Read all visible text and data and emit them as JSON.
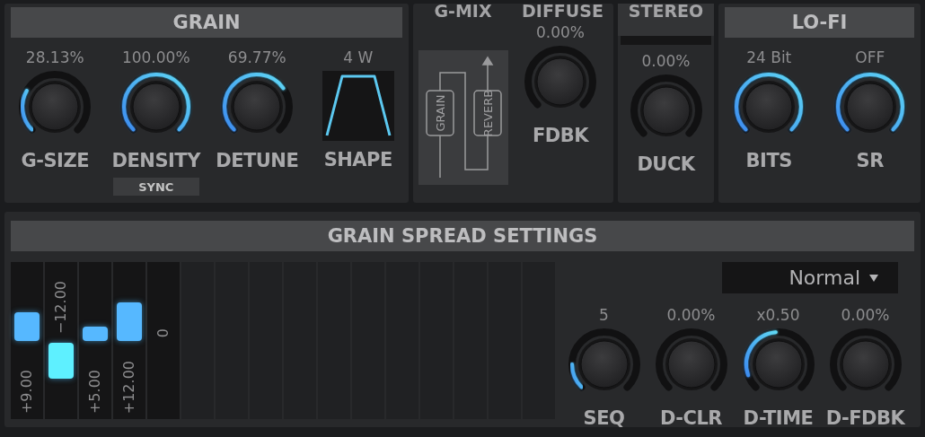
{
  "grain": {
    "title": "GRAIN",
    "controls": [
      {
        "kind": "knob",
        "value": "28.13%",
        "label": "G-SIZE"
      },
      {
        "kind": "knob",
        "value": "100.00%",
        "label": "DENSITY",
        "button": "SYNC"
      },
      {
        "kind": "knob",
        "value": "69.77%",
        "label": "DETUNE"
      },
      {
        "kind": "shape",
        "value": "4 W",
        "label": "SHAPE"
      }
    ]
  },
  "mix": {
    "labels": [
      "G-MIX",
      "DIFFUSE"
    ],
    "routing": [
      "GRAIN",
      "REVERB"
    ],
    "controls": [
      {
        "kind": "knob",
        "value": "0.00%",
        "label": "FDBK"
      }
    ]
  },
  "stereo": {
    "title": "STEREO",
    "controls": [
      {
        "kind": "knob",
        "value": "0.00%",
        "label": "DUCK"
      }
    ]
  },
  "lofi": {
    "title": "LO-FI",
    "controls": [
      {
        "kind": "knob",
        "value": "24 Bit",
        "label": "BITS"
      },
      {
        "kind": "knob",
        "value": "OFF",
        "label": "SR"
      }
    ]
  },
  "spread": {
    "title": "GRAIN SPREAD SETTINGS",
    "mode": "Normal",
    "steps": [
      {
        "value": "+9.00"
      },
      {
        "value": "−12.00"
      },
      {
        "value": "+5.00"
      },
      {
        "value": "+12.00"
      },
      {
        "value": "0"
      }
    ],
    "controls": [
      {
        "kind": "knob",
        "value": "5",
        "label": "SEQ"
      },
      {
        "kind": "knob",
        "value": "0.00%",
        "label": "D-CLR"
      },
      {
        "kind": "knob",
        "value": "x0.50",
        "label": "D-TIME"
      },
      {
        "kind": "knob",
        "value": "0.00%",
        "label": "D-FDBK"
      }
    ]
  }
}
